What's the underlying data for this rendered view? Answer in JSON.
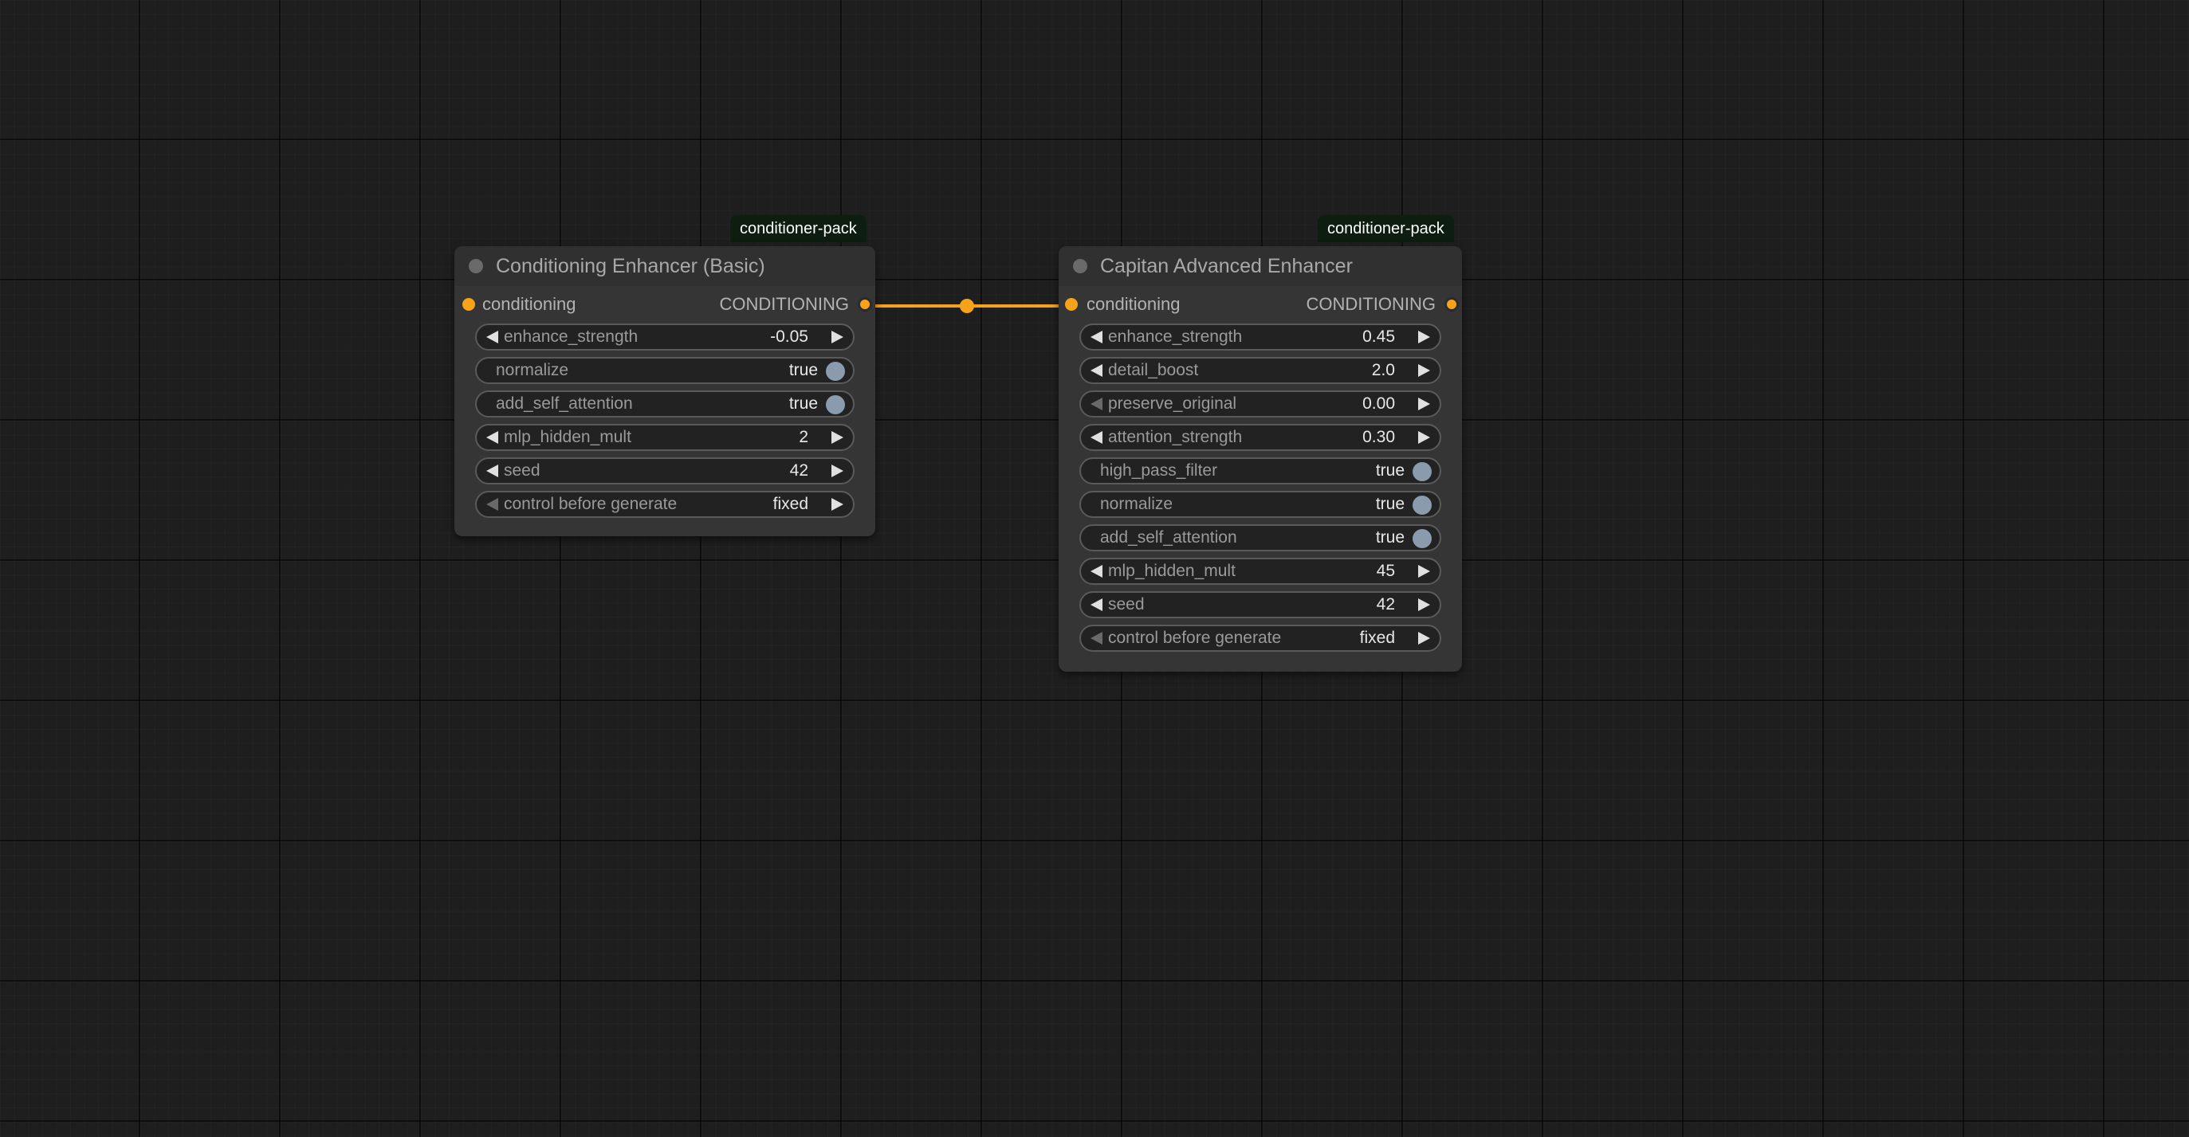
{
  "colors": {
    "link": "#f7a31a",
    "slot": "#f7a31a",
    "toggle_on": "#8a9bae",
    "badge_bg": "#0d1e10",
    "canvas_bg": "#1e1e1e"
  },
  "nodes": [
    {
      "badge": "conditioner-pack",
      "title": "Conditioning Enhancer (Basic)",
      "input_label": "conditioning",
      "output_label": "CONDITIONING",
      "widgets": [
        {
          "name": "enhance_strength",
          "value": "-0.05",
          "type": "number"
        },
        {
          "name": "normalize",
          "value": "true",
          "type": "toggle"
        },
        {
          "name": "add_self_attention",
          "value": "true",
          "type": "toggle"
        },
        {
          "name": "mlp_hidden_mult",
          "value": "2",
          "type": "number"
        },
        {
          "name": "seed",
          "value": "42",
          "type": "number"
        },
        {
          "name": "control before generate",
          "value": "fixed",
          "type": "combo"
        }
      ]
    },
    {
      "badge": "conditioner-pack",
      "title": "Capitan Advanced Enhancer",
      "input_label": "conditioning",
      "output_label": "CONDITIONING",
      "widgets": [
        {
          "name": "enhance_strength",
          "value": "0.45",
          "type": "number"
        },
        {
          "name": "detail_boost",
          "value": "2.0",
          "type": "number"
        },
        {
          "name": "preserve_original",
          "value": "0.00",
          "type": "number-min"
        },
        {
          "name": "attention_strength",
          "value": "0.30",
          "type": "number"
        },
        {
          "name": "high_pass_filter",
          "value": "true",
          "type": "toggle"
        },
        {
          "name": "normalize",
          "value": "true",
          "type": "toggle"
        },
        {
          "name": "add_self_attention",
          "value": "true",
          "type": "toggle"
        },
        {
          "name": "mlp_hidden_mult",
          "value": "45",
          "type": "number"
        },
        {
          "name": "seed",
          "value": "42",
          "type": "number"
        },
        {
          "name": "control before generate",
          "value": "fixed",
          "type": "combo"
        }
      ]
    }
  ]
}
